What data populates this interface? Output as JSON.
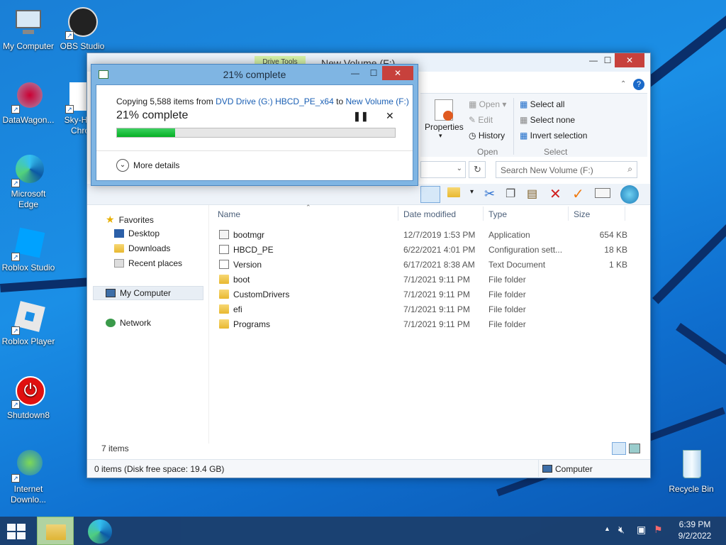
{
  "desktop": {
    "icons": [
      {
        "label": "My Computer"
      },
      {
        "label": "OBS Studio"
      },
      {
        "label": "DataWagon..."
      },
      {
        "label": "Sky-Hi",
        "label2": "Chro"
      },
      {
        "label": "Microsoft",
        "label2": "Edge"
      },
      {
        "label": "Roblox Studio"
      },
      {
        "label": "Roblox Player"
      },
      {
        "label": "Shutdown8"
      },
      {
        "label": "Internet",
        "label2": "Downlo..."
      },
      {
        "label": "Recycle Bin"
      }
    ]
  },
  "explorer": {
    "title": "New Volume (F:)",
    "context_tab": "Drive Tools",
    "ribbon": {
      "properties": "Properties",
      "open": "Open",
      "edit": "Edit",
      "history": "History",
      "open_group": "Open",
      "select_all": "Select all",
      "select_none": "Select none",
      "invert_selection": "Invert selection",
      "select_group": "Select"
    },
    "search_placeholder": "Search New Volume (F:)",
    "nav": {
      "favorites": "Favorites",
      "desktop": "Desktop",
      "downloads": "Downloads",
      "recent": "Recent places",
      "my_computer": "My Computer",
      "network": "Network"
    },
    "columns": {
      "name": "Name",
      "date": "Date modified",
      "type": "Type",
      "size": "Size"
    },
    "files": [
      {
        "name": "bootmgr",
        "date": "12/7/2019 1:53 PM",
        "type": "Application",
        "size": "654 KB",
        "icon": "app"
      },
      {
        "name": "HBCD_PE",
        "date": "6/22/2021 4:01 PM",
        "type": "Configuration sett...",
        "size": "18 KB",
        "icon": "config"
      },
      {
        "name": "Version",
        "date": "6/17/2021 8:38 AM",
        "type": "Text Document",
        "size": "1 KB",
        "icon": "text"
      },
      {
        "name": "boot",
        "date": "7/1/2021 9:11 PM",
        "type": "File folder",
        "size": "",
        "icon": "folder"
      },
      {
        "name": "CustomDrivers",
        "date": "7/1/2021 9:11 PM",
        "type": "File folder",
        "size": "",
        "icon": "folder"
      },
      {
        "name": "efi",
        "date": "7/1/2021 9:11 PM",
        "type": "File folder",
        "size": "",
        "icon": "folder"
      },
      {
        "name": "Programs",
        "date": "7/1/2021 9:11 PM",
        "type": "File folder",
        "size": "",
        "icon": "folder"
      }
    ],
    "item_count": "7 items",
    "status_left": "0 items (Disk free space: 19.4 GB)",
    "status_right": "Computer"
  },
  "copy_dialog": {
    "title": "21% complete",
    "copying_prefix": "Copying 5,588 items from",
    "source": "DVD Drive (G:) HBCD_PE_x64",
    "to": "to",
    "destination": "New Volume (F:)",
    "percent_text": "21% complete",
    "progress": 0.21,
    "more_details": "More details"
  },
  "taskbar": {
    "time": "6:39 PM",
    "date": "9/2/2022"
  },
  "colors": {
    "progress_fill": "#06b025",
    "link": "#1a5fb4",
    "close_button": "#c7413c"
  }
}
